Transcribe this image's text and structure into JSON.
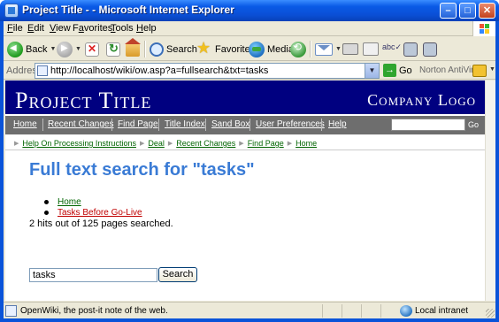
{
  "window": {
    "title": "Project Title - - Microsoft Internet Explorer",
    "buttons": {
      "minimize": "–",
      "maximize": "□",
      "close": "✕"
    }
  },
  "menubar": [
    {
      "pre": "",
      "u": "F",
      "post": "ile"
    },
    {
      "pre": "",
      "u": "E",
      "post": "dit"
    },
    {
      "pre": "",
      "u": "V",
      "post": "iew"
    },
    {
      "pre": "F",
      "u": "a",
      "post": "vorites"
    },
    {
      "pre": "",
      "u": "T",
      "post": "ools"
    },
    {
      "pre": "",
      "u": "H",
      "post": "elp"
    }
  ],
  "toolbar": {
    "back": "Back",
    "search": "Search",
    "favorites": "Favorites",
    "media": "Media"
  },
  "address": {
    "label": "Address",
    "url": "http://localhost/wiki/ow.asp?a=fullsearch&txt=tasks",
    "go": "Go",
    "norton": "Norton AntiVirus"
  },
  "site": {
    "title": "Project Title",
    "logo": "Company Logo",
    "nav": [
      "Home",
      "Recent Changes",
      "Find Page",
      "Title Index",
      "Sand Box",
      "User Preferences",
      "Help"
    ],
    "nav_go": "Go",
    "breadcrumb": [
      "Help On Processing Instructions",
      "Deal",
      "Recent Changes",
      "Find Page",
      "Home"
    ]
  },
  "content": {
    "heading": "Full text search for \"tasks\"",
    "results": [
      {
        "label": "Home",
        "color": "#006400"
      },
      {
        "label": "Tasks Before Go-Live",
        "color": "#c00000"
      }
    ],
    "hits": "2 hits out of 125 pages searched.",
    "search_value": "tasks",
    "search_button": "Search"
  },
  "status": {
    "text": "OpenWiki, the post-it note of the web.",
    "zone": "Local intranet"
  },
  "colors": {
    "header_bg": "#000080",
    "nav_bg": "#6e6e6e",
    "heading": "#3a7bd5"
  }
}
